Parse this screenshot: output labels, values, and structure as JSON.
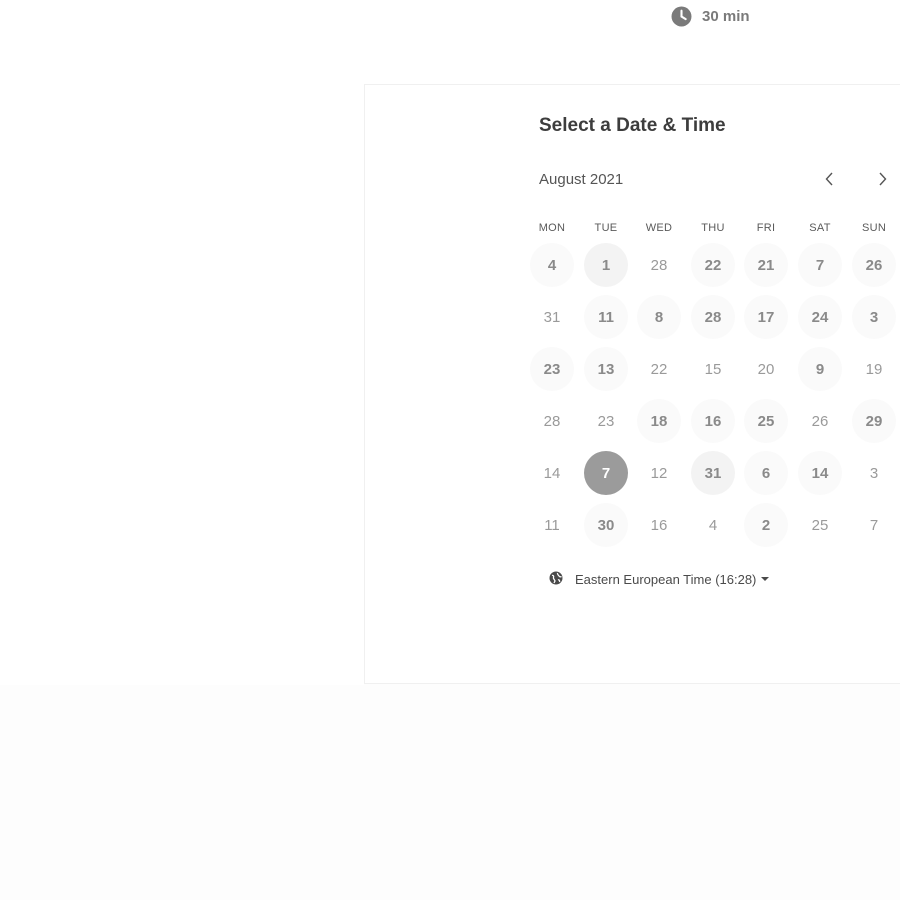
{
  "event": {
    "duration": "30 min",
    "icon": "clock-icon"
  },
  "scheduler": {
    "title": "Select a Date & Time",
    "month": "August 2021",
    "prev_icon": "chevron-left-icon",
    "next_icon": "chevron-right-icon",
    "weekdays": [
      "MON",
      "TUE",
      "WED",
      "THU",
      "FRI",
      "SAT",
      "SUN"
    ],
    "weeks": [
      [
        {
          "label": "4",
          "available": true
        },
        {
          "label": "1",
          "available": true,
          "highlight": true
        },
        {
          "label": "28",
          "available": false
        },
        {
          "label": "22",
          "available": true
        },
        {
          "label": "21",
          "available": true
        },
        {
          "label": "7",
          "available": true
        },
        {
          "label": "26",
          "available": true
        }
      ],
      [
        {
          "label": "31",
          "available": false
        },
        {
          "label": "11",
          "available": true
        },
        {
          "label": "8",
          "available": true
        },
        {
          "label": "28",
          "available": true
        },
        {
          "label": "17",
          "available": true
        },
        {
          "label": "24",
          "available": true
        },
        {
          "label": "3",
          "available": true
        }
      ],
      [
        {
          "label": "23",
          "available": true
        },
        {
          "label": "13",
          "available": true
        },
        {
          "label": "22",
          "available": false
        },
        {
          "label": "15",
          "available": false
        },
        {
          "label": "20",
          "available": false
        },
        {
          "label": "9",
          "available": true
        },
        {
          "label": "19",
          "available": false
        }
      ],
      [
        {
          "label": "28",
          "available": false
        },
        {
          "label": "23",
          "available": false
        },
        {
          "label": "18",
          "available": true
        },
        {
          "label": "16",
          "available": true
        },
        {
          "label": "25",
          "available": true
        },
        {
          "label": "26",
          "available": false
        },
        {
          "label": "29",
          "available": true
        }
      ],
      [
        {
          "label": "14",
          "available": false
        },
        {
          "label": "7",
          "available": true,
          "selected": true
        },
        {
          "label": "12",
          "available": false
        },
        {
          "label": "31",
          "available": true,
          "highlight": true
        },
        {
          "label": "6",
          "available": true
        },
        {
          "label": "14",
          "available": true
        },
        {
          "label": "3",
          "available": false
        }
      ],
      [
        {
          "label": "11",
          "available": false
        },
        {
          "label": "30",
          "available": true
        },
        {
          "label": "16",
          "available": false
        },
        {
          "label": "4",
          "available": false
        },
        {
          "label": "2",
          "available": true
        },
        {
          "label": "25",
          "available": false
        },
        {
          "label": "7",
          "available": false
        }
      ]
    ],
    "timezone": {
      "label": "Eastern European Time (16:28)",
      "icon": "globe-icon",
      "dropdown_icon": "caret-down-icon"
    }
  },
  "colors": {
    "selected_day": "#9b9b9b",
    "available_day_bg": "#fafafa",
    "text": "#4a4a4a"
  }
}
